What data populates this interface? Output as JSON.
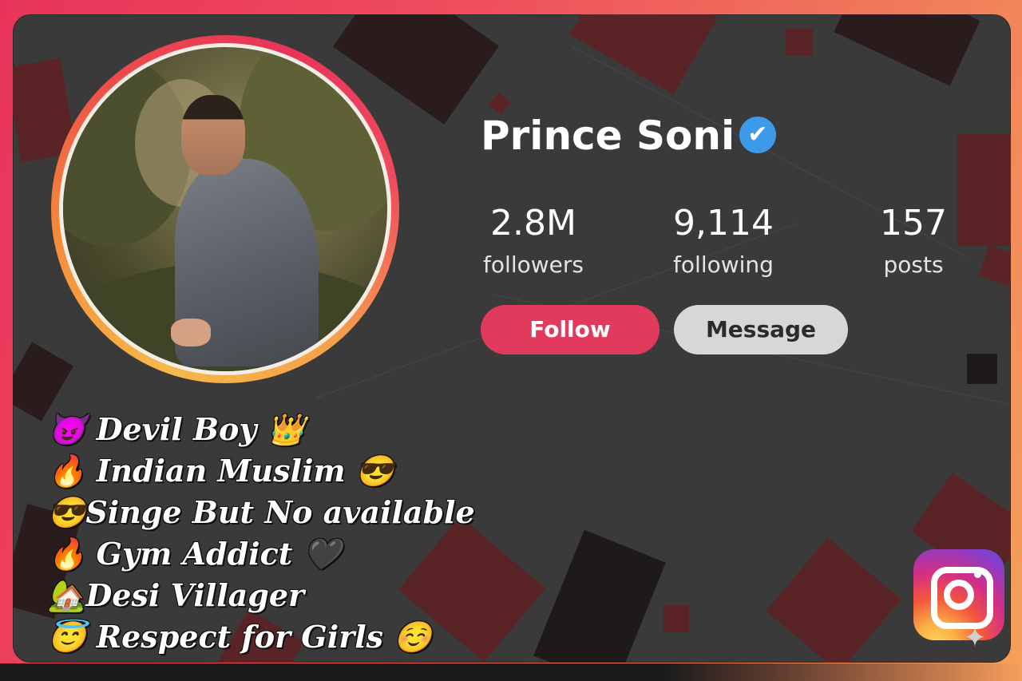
{
  "profile": {
    "name": "Prince Soni",
    "verified_icon": "✔",
    "stats": [
      {
        "value": "2.8M",
        "label": "followers"
      },
      {
        "value": "9,114",
        "label": "following"
      },
      {
        "value": "157",
        "label": "posts"
      }
    ],
    "follow_label": "Follow",
    "message_label": "Message"
  },
  "bio": [
    "😈 Devil Boy 👑",
    "🔥 Indian Muslim 😎",
    "😎Singe But No available",
    "🔥 Gym Addict 🖤",
    "🏡Desi Villager",
    "😇 Respect for Girls ☺️"
  ],
  "icons": {
    "verified": "verified-badge-icon",
    "instagram": "instagram-logo-icon",
    "sparkle": "✦"
  },
  "colors": {
    "accent": "#e23a5c",
    "verified": "#3d9ae8",
    "message_button": "#d7d7d7",
    "card_background": "#3a3a3a"
  }
}
